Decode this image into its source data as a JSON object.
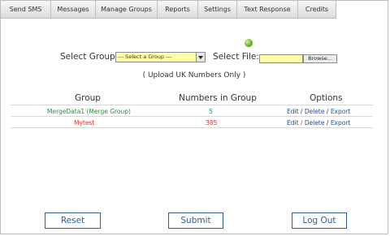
{
  "tabs": [
    {
      "label": "Send SMS"
    },
    {
      "label": "Messages"
    },
    {
      "label": "Manage Groups"
    },
    {
      "label": "Reports"
    },
    {
      "label": "Settings"
    },
    {
      "label": "Text Response"
    },
    {
      "label": "Credits"
    }
  ],
  "form": {
    "select_group_label": "Select Group:",
    "select_group_value": "--- Select a Group ---",
    "select_file_label": "Select File:",
    "browse_label": "Browse...",
    "hint": "( Upload UK Numbers Only )"
  },
  "table": {
    "headers": [
      "Group",
      "Numbers in Group",
      "Options"
    ],
    "rows": [
      {
        "group": "MergeData1 (Merge Group)",
        "count": "5",
        "edit": "Edit",
        "delete": "Delete",
        "export": "Export",
        "color": "#2e8b3d"
      },
      {
        "group": "Mytest",
        "count": "385",
        "edit": "Edit",
        "delete": "Delete",
        "export": "Export",
        "color": "#e53030"
      }
    ],
    "sep": "/"
  },
  "buttons": {
    "reset": "Reset",
    "submit": "Submit",
    "logout": "Log Out"
  },
  "colors": {
    "field_bg": "#ffffa6",
    "button_border": "#2f5f95",
    "link": "#1f4f8f"
  }
}
